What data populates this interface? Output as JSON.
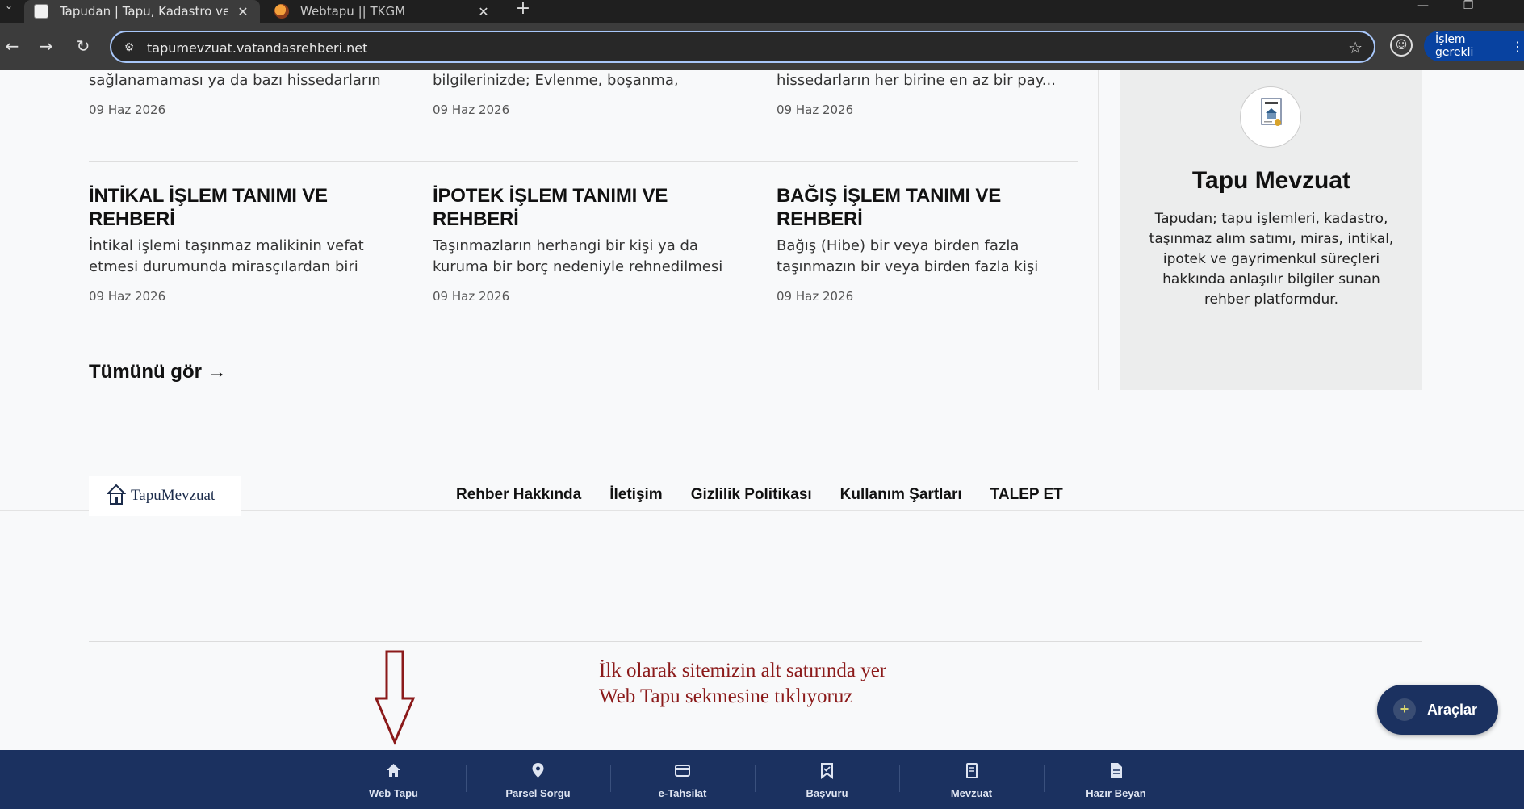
{
  "browser": {
    "tabs": [
      {
        "title": "Tapudan | Tapu, Kadastro ve Ga",
        "active": true
      },
      {
        "title": "Webtapu || TKGM",
        "active": false
      }
    ],
    "url": "tapumevzuat.vatandasrehberi.net",
    "action_pill": "İşlem gerekli"
  },
  "articles_top": [
    {
      "excerpt": "sağlanamaması ya da bazı hissedarların ki...",
      "date": "09 Haz 2026"
    },
    {
      "excerpt": "bilgilerinizde; Evlenme, boşanma, Mahkem...",
      "date": "09 Haz 2026"
    },
    {
      "excerpt": "hissedarların her birine en az bir pay...",
      "date": "09 Haz 2026"
    }
  ],
  "articles": [
    {
      "title": "İNTİKAL İŞLEM TANIMI VE REHBERİ",
      "excerpt": "İntikal işlemi taşınmaz malikinin vefat etmesi durumunda mirasçılardan biri veya...",
      "date": "09 Haz 2026"
    },
    {
      "title": "İPOTEK İŞLEM TANIMI VE REHBERİ",
      "excerpt": "Taşınmazların herhangi bir kişi ya da kuruma bir borç nedeniyle rehnedilmesi Tapu...",
      "date": "09 Haz 2026"
    },
    {
      "title": "BAĞIŞ İŞLEM TANIMI VE REHBERİ",
      "excerpt": "Bağış (Hibe) bir veya birden fazla taşınmazın bir veya birden fazla kişi tarafından bir veya...",
      "date": "09 Haz 2026"
    }
  ],
  "see_all": "Tümünü gör →",
  "sidebar": {
    "title": "Tapu Mevzuat",
    "description": "Tapudan; tapu işlemleri, kadastro, taşınmaz alım satımı, miras, intikal, ipotek ve gayrimenkul süreçleri hakkında anlaşılır bilgiler sunan rehber platformdur."
  },
  "footer": {
    "brand": "TapuMevzuat",
    "links": [
      "Rehber Hakkında",
      "İletişim",
      "Gizlilik Politikası",
      "Kullanım Şartları",
      "TALEP ET"
    ]
  },
  "annotation": {
    "line1": "İlk olarak sitemizin alt satırında yer",
    "line2": "Web Tapu sekmesine tıklıyoruz"
  },
  "tools_button": "Araçlar",
  "bottom_nav": [
    {
      "label": "Web Tapu",
      "icon": "home-icon"
    },
    {
      "label": "Parsel Sorgu",
      "icon": "map-pin-icon"
    },
    {
      "label": "e-Tahsilat",
      "icon": "credit-card-icon"
    },
    {
      "label": "Başvuru",
      "icon": "bookmark-check-icon"
    },
    {
      "label": "Mevzuat",
      "icon": "book-icon"
    },
    {
      "label": "Hazır Beyan",
      "icon": "document-icon"
    }
  ],
  "colors": {
    "nav_bg": "#1b3160",
    "annotation": "#8b1a1a",
    "accent_url_border": "#a8c7fa"
  }
}
